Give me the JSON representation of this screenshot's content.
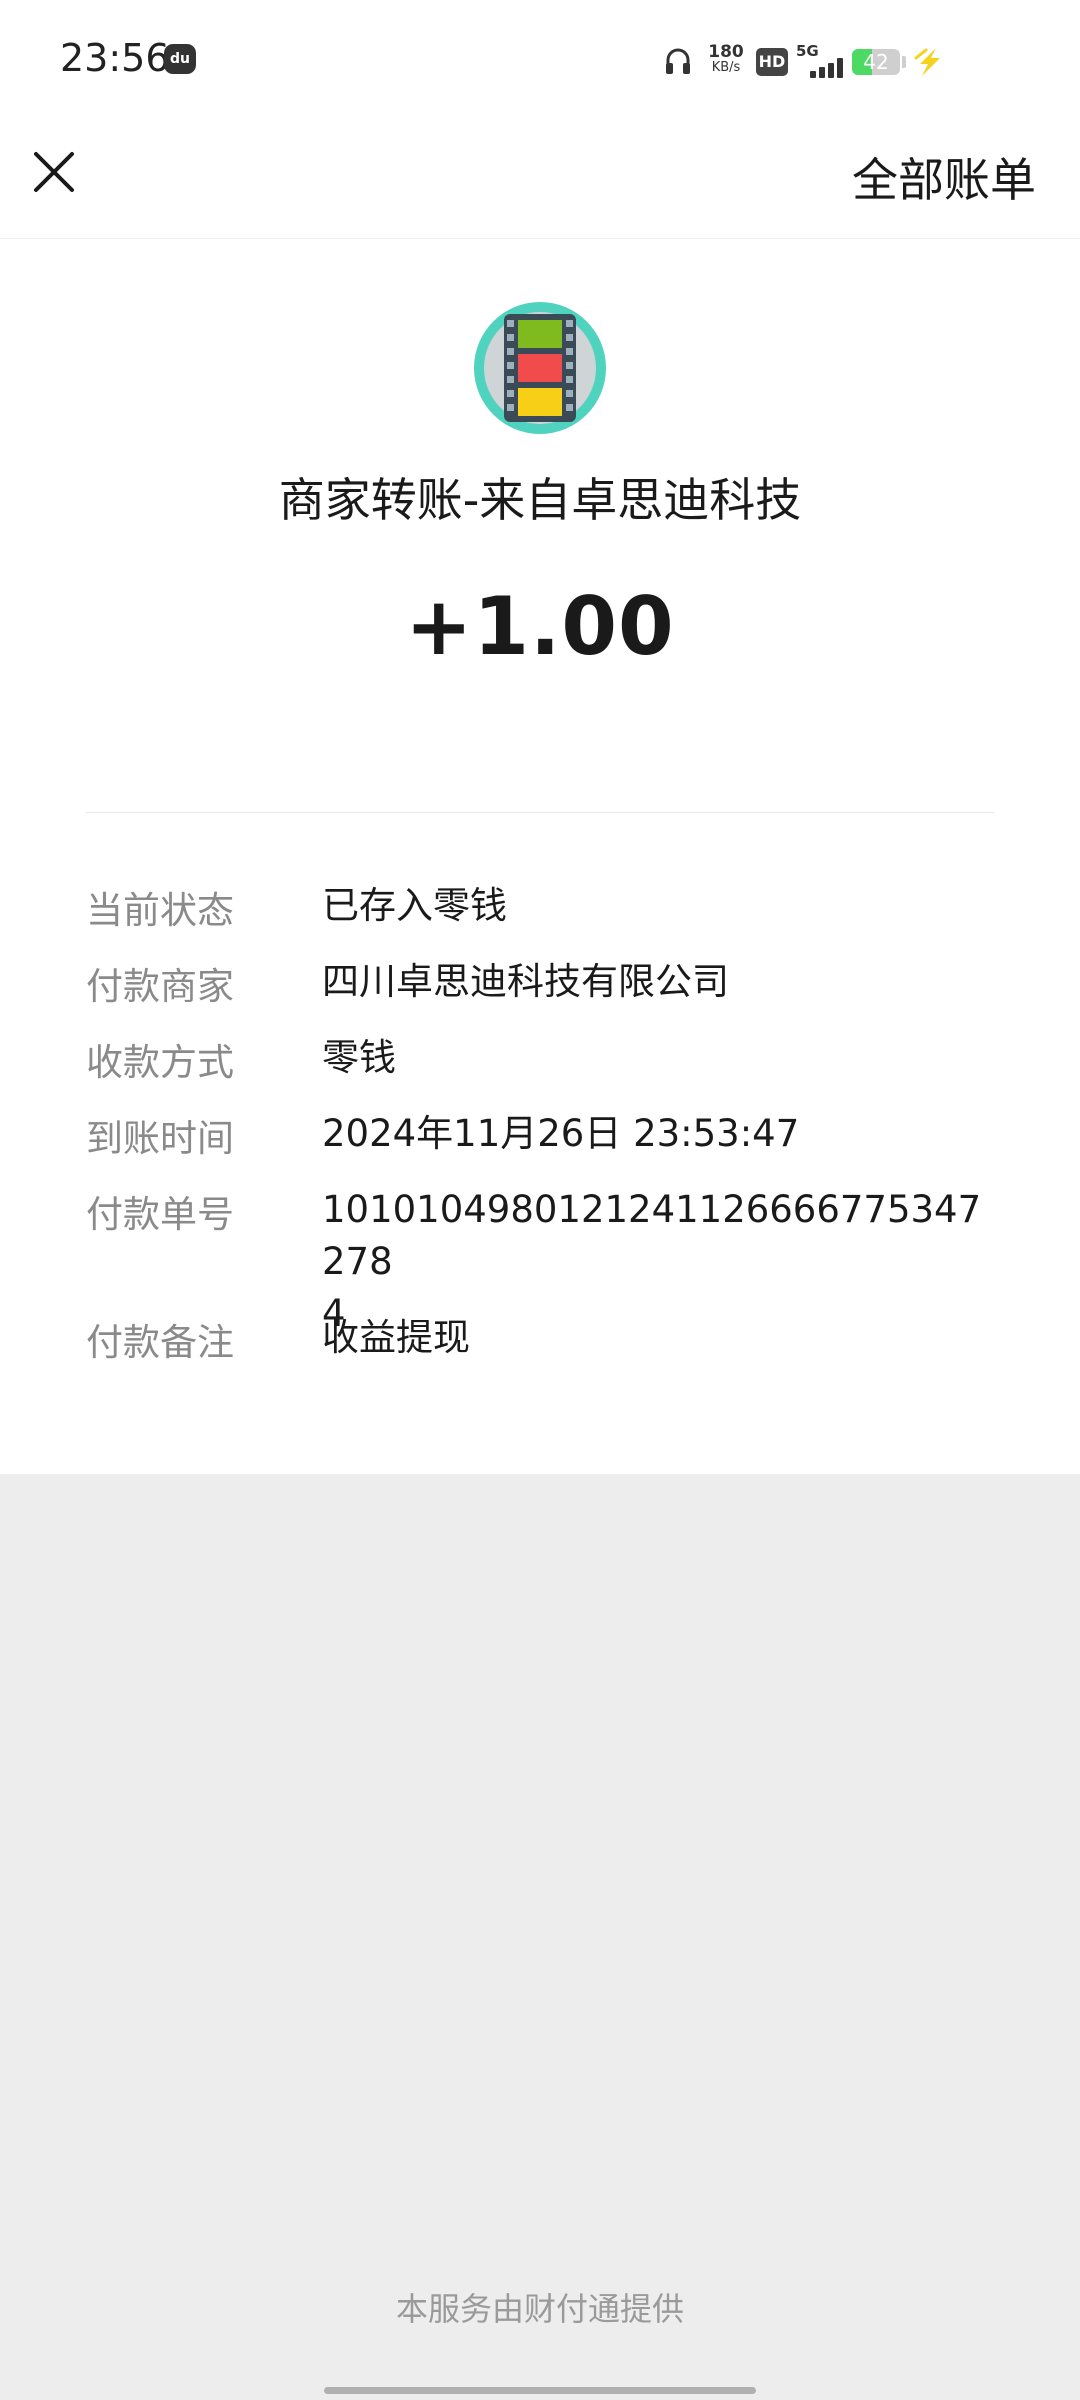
{
  "status_bar": {
    "time": "23:56",
    "du_badge": "du",
    "net_speed_value": "180",
    "net_speed_unit": "KB/s",
    "hd_label": "HD",
    "network_label": "5G",
    "battery_level": "42",
    "battery_fraction": 0.42
  },
  "nav": {
    "close_icon": "close-icon",
    "all_bills_label": "全部账单"
  },
  "header": {
    "avatar_icon": "film-strip-icon",
    "merchant_title": "商家转账-来自卓思迪科技",
    "amount": "+1.00"
  },
  "details": [
    {
      "label": "当前状态",
      "value": "已存入零钱"
    },
    {
      "label": "付款商家",
      "value": "四川卓思迪科技有限公司"
    },
    {
      "label": "收款方式",
      "value": "零钱"
    },
    {
      "label": "到账时间",
      "value": "2024年11月26日 23:53:47"
    },
    {
      "label": "付款单号",
      "value": "1010104980121241126666775347278\n4"
    },
    {
      "label": "付款备注",
      "value": "收益提现"
    }
  ],
  "footer": {
    "provider_text": "本服务由财付通提供"
  },
  "colors": {
    "accent_teal": "#4fd3bf",
    "background_gray": "#ededed",
    "battery_green": "#4cd964",
    "charge_yellow": "#f5d21c"
  }
}
